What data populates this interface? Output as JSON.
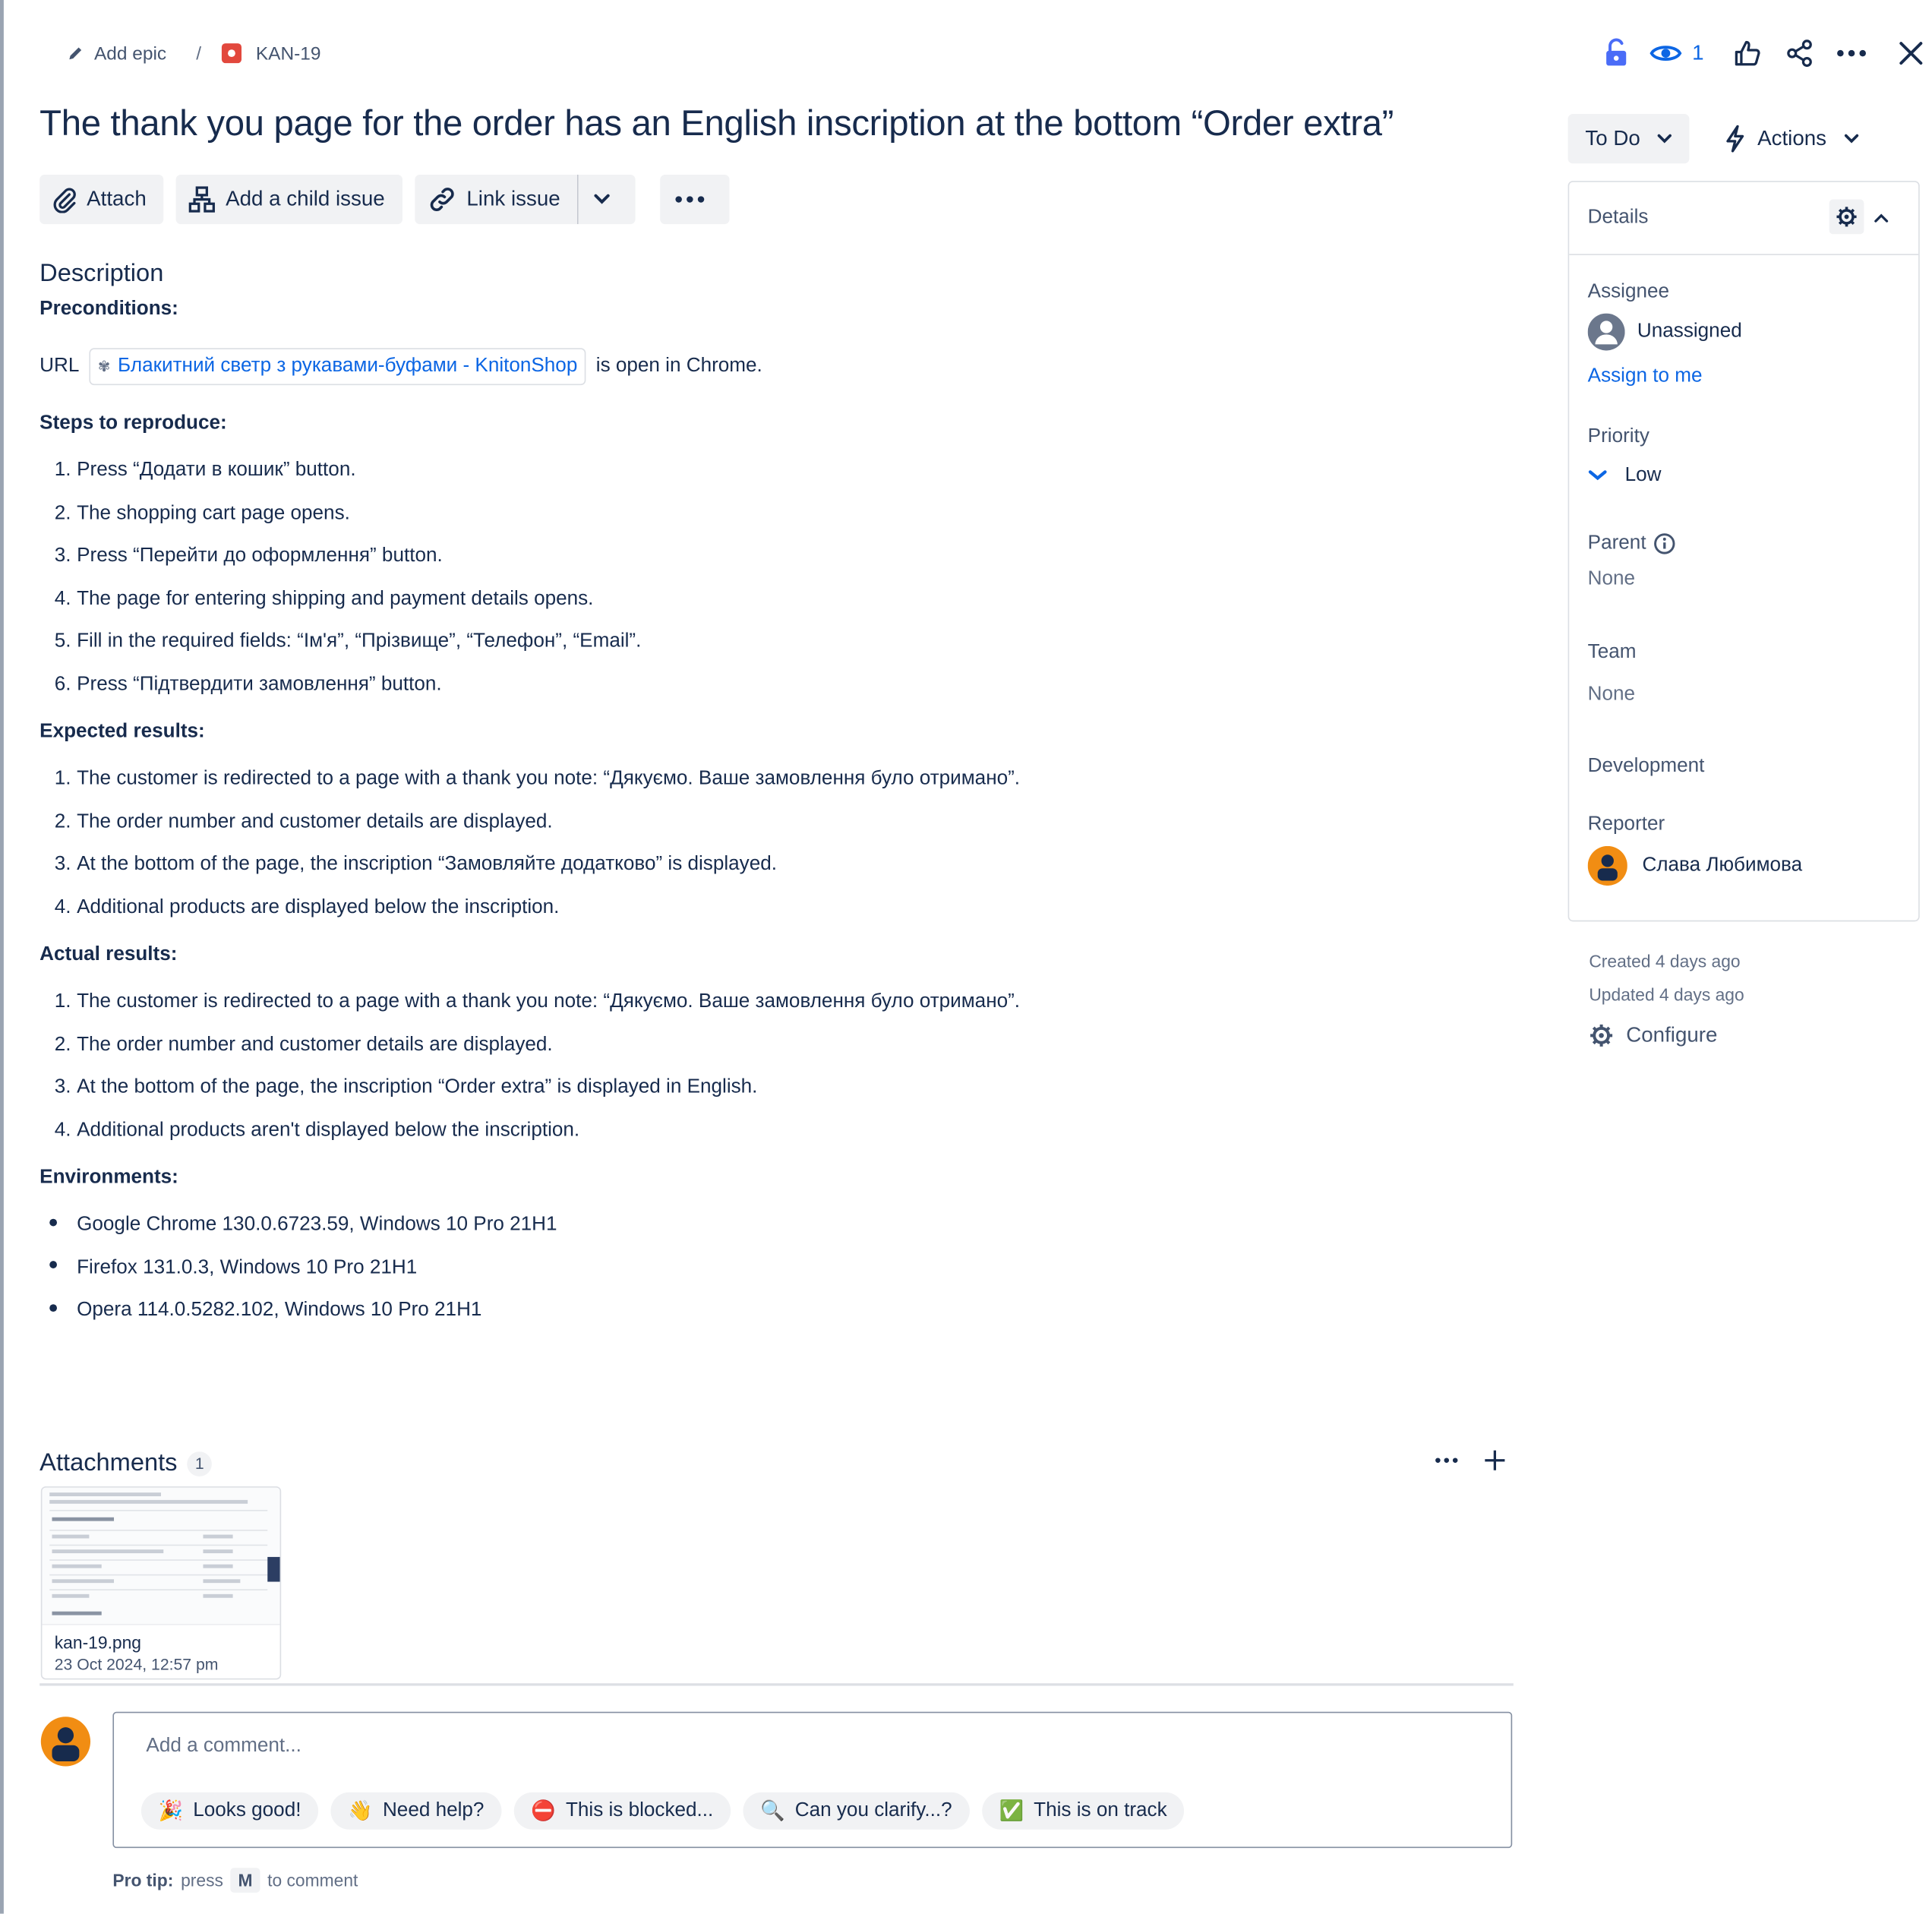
{
  "breadcrumb": {
    "epic_label": "Add epic",
    "separator": "/",
    "issue_key": "KAN-19"
  },
  "header": {
    "watch_count": "1"
  },
  "issue": {
    "title": "The thank you page for the order has an English inscription at the bottom “Order extra”"
  },
  "toolbar": {
    "attach_label": "Attach",
    "child_label": "Add a child issue",
    "link_label": "Link issue"
  },
  "description": {
    "heading": "Description",
    "preconditions_heading": "Preconditions:",
    "url_prefix": "URL",
    "url_chip": "Блакитний светр з рукавами-буфами - KnitonShop",
    "url_suffix": "is open in Chrome.",
    "steps_heading": "Steps to reproduce:",
    "steps": [
      {
        "n": "1.",
        "text": "Press “Додати в кошик” button."
      },
      {
        "n": "2.",
        "text": "The shopping cart page opens."
      },
      {
        "n": "3.",
        "text": "Press “Перейти до оформлення” button."
      },
      {
        "n": "4.",
        "text": "The page for entering shipping and payment details opens."
      },
      {
        "n": "5.",
        "text": "Fill in the required fields: “Ім'я”, “Прізвище”, “Телефон”, “Email”."
      },
      {
        "n": "6.",
        "text": "Press “Підтвердити замовлення” button."
      }
    ],
    "expected_heading": "Expected results:",
    "expected": [
      {
        "n": "1.",
        "text": "The customer is redirected to a page with a thank you note: “Дякуємо. Ваше замовлення було отримано”."
      },
      {
        "n": "2.",
        "text": "The order number and customer details are displayed."
      },
      {
        "n": "3.",
        "text": "At the bottom of the page, the inscription “Замовляйте додатково” is displayed."
      },
      {
        "n": "4.",
        "text": "Additional products are displayed below the inscription."
      }
    ],
    "actual_heading": "Actual results:",
    "actual": [
      {
        "n": "1.",
        "text": "The customer is redirected to a page with a thank you note: “Дякуємо. Ваше замовлення було отримано”."
      },
      {
        "n": "2.",
        "text": "The order number and customer details are displayed."
      },
      {
        "n": "3.",
        "text": "At the bottom of the page, the inscription “Order extra” is displayed in English."
      },
      {
        "n": "4.",
        "text": "Additional products aren't displayed below the inscription."
      }
    ],
    "env_heading": "Environments:",
    "environments": [
      "Google Chrome 130.0.6723.59, Windows 10 Pro 21H1",
      "Firefox 131.0.3, Windows 10 Pro 21H1",
      "Opera 114.0.5282.102, Windows 10 Pro 21H1"
    ]
  },
  "attachments": {
    "heading": "Attachments",
    "count": "1",
    "file_name": "kan-19.png",
    "file_date": "23 Oct 2024, 12:57 pm"
  },
  "comment": {
    "placeholder": "Add a comment...",
    "quick": [
      {
        "emoji": "🎉",
        "label": "Looks good!"
      },
      {
        "emoji": "👋",
        "label": "Need help?"
      },
      {
        "emoji": "⛔",
        "label": "This is blocked..."
      },
      {
        "emoji": "🔍",
        "label": "Can you clarify...?"
      },
      {
        "emoji": "✅",
        "label": "This is on track"
      }
    ],
    "protip_label": "Pro tip:",
    "protip_press": "press",
    "protip_key": "M",
    "protip_suffix": "to comment"
  },
  "sidebar": {
    "status": "To Do",
    "actions_label": "Actions",
    "details_label": "Details",
    "assignee_label": "Assignee",
    "assignee_value": "Unassigned",
    "assign_to_me": "Assign to me",
    "priority_label": "Priority",
    "priority_value": "Low",
    "parent_label": "Parent",
    "parent_value": "None",
    "team_label": "Team",
    "team_value": "None",
    "development_label": "Development",
    "reporter_label": "Reporter",
    "reporter_value": "Слава Любимова",
    "created": "Created 4 days ago",
    "updated": "Updated 4 days ago",
    "configure_label": "Configure"
  },
  "colors": {
    "accent": "#0c66e4",
    "bug": "#e2483d",
    "avatar": "#f18d13"
  }
}
